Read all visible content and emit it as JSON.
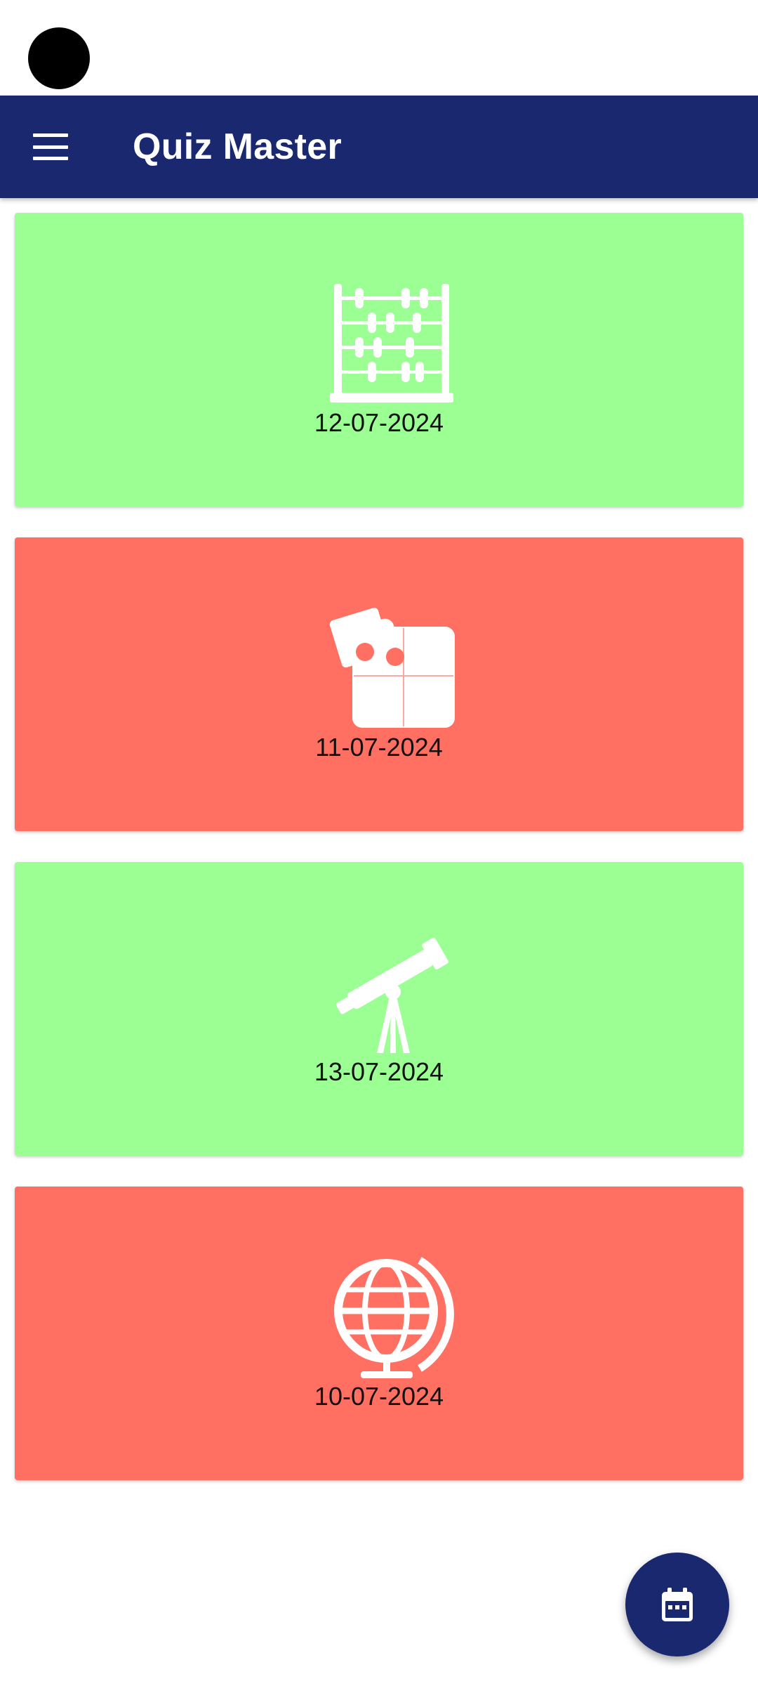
{
  "app_bar": {
    "title": "Quiz Master",
    "menu_icon": "menu-icon",
    "background": "#1a2870"
  },
  "quizzes": [
    {
      "date": "12-07-2024",
      "icon": "abacus-icon",
      "color": "#9cff94"
    },
    {
      "date": "11-07-2024",
      "icon": "puzzle-icon",
      "color": "#ff7062"
    },
    {
      "date": "13-07-2024",
      "icon": "telescope-icon",
      "color": "#9cff94"
    },
    {
      "date": "10-07-2024",
      "icon": "globe-icon",
      "color": "#ff7062"
    }
  ],
  "fab": {
    "icon": "calendar-icon",
    "background": "#1a2870"
  }
}
